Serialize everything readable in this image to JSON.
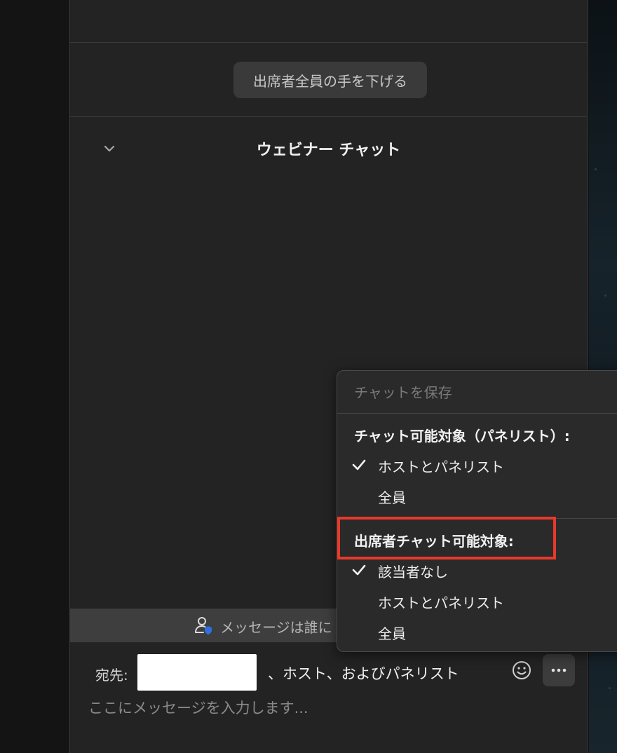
{
  "panel": {
    "lower_hands_button": "出席者全員の手を下げる",
    "chat_title": "ウェビナー チャット"
  },
  "visibility_bar": {
    "text": "メッセージは誰に"
  },
  "composer": {
    "to_label": "宛先:",
    "to_suffix": "、ホスト、およびパネリスト",
    "input_placeholder": "ここにメッセージを入力します..."
  },
  "menu": {
    "save_chat": "チャットを保存",
    "panelist_section_header": "チャット可能対象（パネリスト）:",
    "panelist_options": [
      {
        "label": "ホストとパネリスト",
        "checked": true
      },
      {
        "label": "全員",
        "checked": false
      }
    ],
    "attendee_section_header": "出席者チャット可能対象:",
    "attendee_options": [
      {
        "label": "該当者なし",
        "checked": true
      },
      {
        "label": "ホストとパネリスト",
        "checked": false
      },
      {
        "label": "全員",
        "checked": false
      }
    ]
  },
  "colors": {
    "panel_bg": "#232323",
    "menu_bg": "#2a2a2a",
    "highlight": "#e8392a",
    "accent_blue": "#2f6fe0"
  }
}
